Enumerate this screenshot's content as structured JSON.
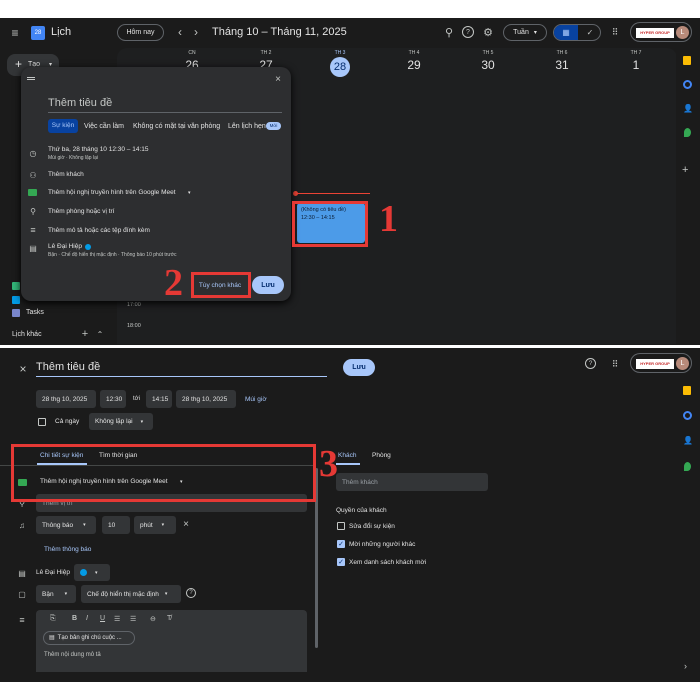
{
  "top": {
    "app_title": "Lịch",
    "today_button": "Hôm nay",
    "date_range": "Tháng 10 – Tháng 11, 2025",
    "view_select": "Tuần",
    "account_badge": "HYPER GROUP",
    "avatar_letter": "L",
    "create_button": "Tạo",
    "days": [
      {
        "name": "CN",
        "num": "26"
      },
      {
        "name": "TH 2",
        "num": "27"
      },
      {
        "name": "TH 3",
        "num": "28"
      },
      {
        "name": "TH 4",
        "num": "29"
      },
      {
        "name": "TH 5",
        "num": "30"
      },
      {
        "name": "TH 6",
        "num": "31"
      },
      {
        "name": "TH 7",
        "num": "1"
      }
    ],
    "time_labels": [
      "17:00",
      "18:00"
    ],
    "event": {
      "title": "(Không có tiêu đề)",
      "time": "12:30 – 14:15"
    },
    "sidebar": {
      "tasks_label": "Tasks",
      "other_calendars": "Lịch khác"
    },
    "popup": {
      "title_placeholder": "Thêm tiêu đề",
      "tabs": [
        "Sự kiện",
        "Việc cần làm",
        "Không có mặt tại văn phòng",
        "Lên lịch hẹn"
      ],
      "new_badge": "Mới",
      "date_line": "Thứ ba, 28 tháng 10    12:30  –  14:15",
      "date_sub": "Múi giờ · Không lặp lại",
      "add_guests": "Thêm khách",
      "meet": "Thêm hội nghị truyền hình trên Google Meet",
      "location": "Thêm phòng hoặc vị trí",
      "description": "Thêm mô tả hoặc các tệp đính kèm",
      "owner_name": "Lê Đại Hiệp",
      "owner_sub": "Bận · Chế độ hiển thị mặc định · Thông báo 10 phút trước",
      "more_options": "Tùy chọn khác",
      "save": "Lưu"
    }
  },
  "bottom": {
    "title": "Thêm tiêu đề",
    "save": "Lưu",
    "account_badge": "HYPER GROUP",
    "avatar_letter": "L",
    "start_date": "28 thg 10, 2025",
    "start_time": "12:30",
    "to_label": "tới",
    "end_time": "14:15",
    "end_date": "28 thg 10, 2025",
    "timezone": "Múi giờ",
    "all_day": "Cả ngày",
    "repeat": "Không lặp lại",
    "tabs": [
      "Chi tiết sự kiện",
      "Tìm thời gian"
    ],
    "meet": "Thêm hội nghị truyền hình trên Google Meet",
    "location_placeholder": "Thêm vị trí",
    "notify_type": "Thông báo",
    "notify_value": "10",
    "notify_unit": "phút",
    "add_notification": "Thêm thông báo",
    "owner_name": "Lê Đại Hiệp",
    "busy": "Bận",
    "visibility": "Chế độ hiển thị mặc định",
    "note_button": "Tạo bản ghi chú cuộc ...",
    "desc_placeholder": "Thêm nội dung mô tả",
    "guest_tabs": [
      "Khách",
      "Phòng"
    ],
    "add_guests_placeholder": "Thêm khách",
    "guest_permissions_title": "Quyền của khách",
    "permissions": [
      {
        "label": "Sửa đổi sự kiện",
        "checked": false
      },
      {
        "label": "Mời những người khác",
        "checked": true
      },
      {
        "label": "Xem danh sách khách mời",
        "checked": true
      }
    ]
  },
  "annotations": [
    "1",
    "2",
    "3"
  ],
  "colors": {
    "accent": "#a8c7fa",
    "event": "#4c9be8",
    "annotation": "#e53935",
    "today": "#a8c7fa"
  }
}
